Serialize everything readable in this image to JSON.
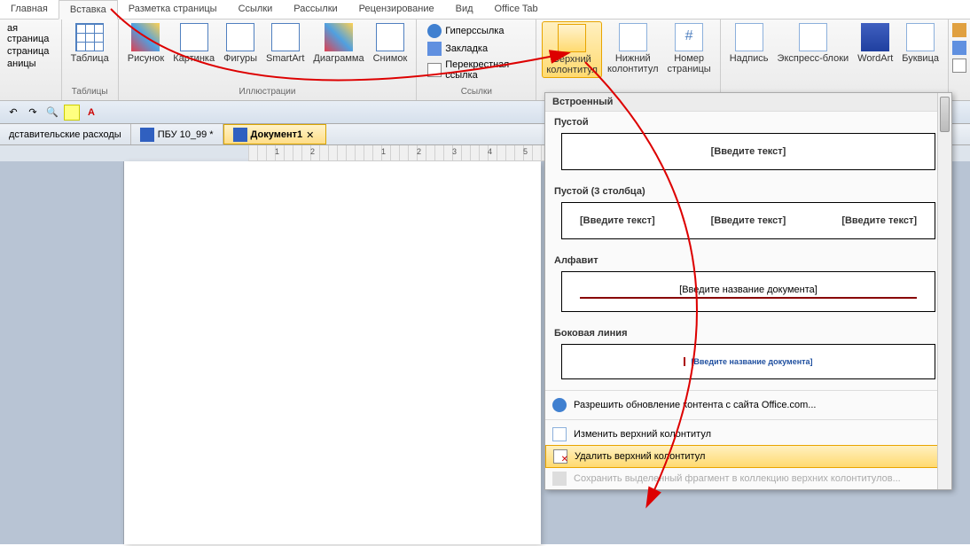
{
  "tabs": {
    "home": "Главная",
    "insert": "Вставка",
    "layout": "Разметка страницы",
    "refs": "Ссылки",
    "mail": "Рассылки",
    "review": "Рецензирование",
    "view": "Вид",
    "office": "Office Tab"
  },
  "ribbon": {
    "pages": {
      "cover": "ая страница",
      "blank": "страница",
      "break": "аницы",
      "label": ""
    },
    "tables": {
      "btn": "Таблица",
      "label": "Таблицы"
    },
    "illus": {
      "picture": "Рисунок",
      "clip": "Картинка",
      "shapes": "Фигуры",
      "smartart": "SmartArt",
      "chart": "Диаграмма",
      "screenshot": "Снимок",
      "label": "Иллюстрации"
    },
    "links": {
      "hyper": "Гиперссылка",
      "bookmark": "Закладка",
      "cross": "Перекрестная ссылка",
      "label": "Ссылки"
    },
    "hf": {
      "header": "Верхний\nколонтитул",
      "footer": "Нижний\nколонтитул",
      "pagenum": "Номер\nстраницы"
    },
    "text": {
      "textbox": "Надпись",
      "quick": "Экспресс-блоки",
      "wordart": "WordArt",
      "dropcap": "Буквица"
    }
  },
  "doctabs": {
    "t1": "дставительские расходы",
    "t2": "ПБУ 10_99 *",
    "t3": "Документ1"
  },
  "dropdown": {
    "builtin": "Встроенный",
    "empty": "Пустой",
    "empty3": "Пустой (3 столбца)",
    "alphabet": "Алфавит",
    "sideline": "Боковая линия",
    "ph_text": "[Введите текст]",
    "ph_title": "[Введите название документа]",
    "office_com": "Разрешить обновление контента с сайта Office.com...",
    "edit": "Изменить верхний колонтитул",
    "remove": "Удалить верхний колонтитул",
    "save": "Сохранить выделенный фрагмент в коллекцию верхних колонтитулов..."
  }
}
